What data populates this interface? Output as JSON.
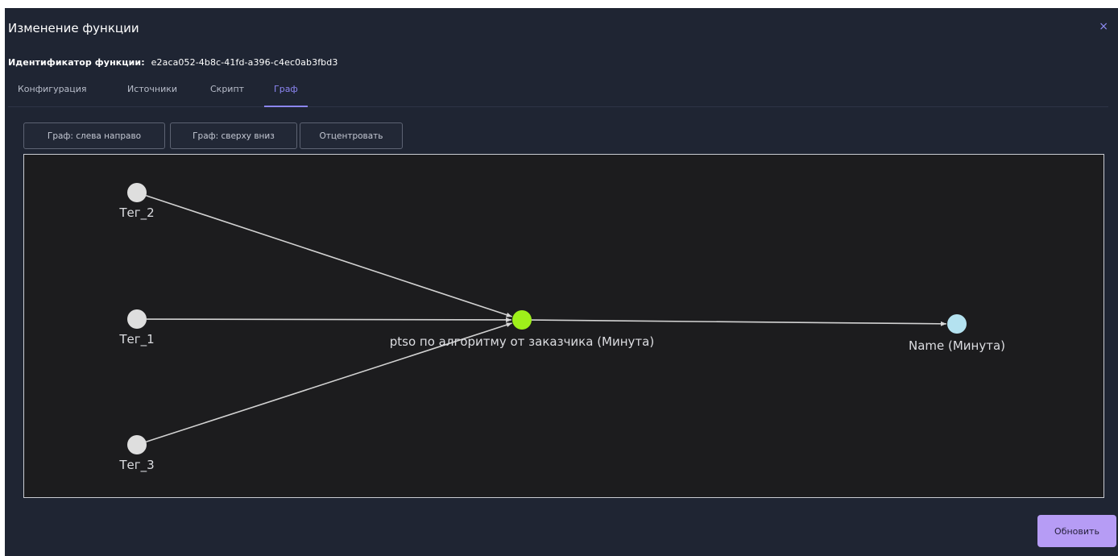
{
  "dialog": {
    "title": "Изменение функции",
    "close_symbol": "×",
    "function_id_label": "Идентификатор функции:",
    "function_id_value": "e2aca052-4b8c-41fd-a396-c4ec0ab3fbd3"
  },
  "tabs": [
    {
      "label": "Конфигурация",
      "active": false
    },
    {
      "label": "Источники",
      "active": false
    },
    {
      "label": "Скрипт",
      "active": false
    },
    {
      "label": "Граф",
      "active": true
    }
  ],
  "toolbar": {
    "left_to_right": "Граф: слева направо",
    "top_to_bottom": "Граф: сверху вниз",
    "center": "Отцентровать"
  },
  "graph": {
    "nodes": [
      {
        "id": "teg2",
        "label": "Тег_2",
        "color": "#dedede"
      },
      {
        "id": "teg1",
        "label": "Тег_1",
        "color": "#dedede"
      },
      {
        "id": "teg3",
        "label": "Тег_3",
        "color": "#dedede"
      },
      {
        "id": "func",
        "label": "ptso по алгоритму от заказчика (Минута)",
        "color": "#9ef01a"
      },
      {
        "id": "out",
        "label": "Name (Минута)",
        "color": "#b4e2f0"
      }
    ],
    "edges": [
      {
        "from": "teg2",
        "to": "func"
      },
      {
        "from": "teg1",
        "to": "func"
      },
      {
        "from": "teg3",
        "to": "func"
      },
      {
        "from": "func",
        "to": "out"
      }
    ]
  },
  "footer": {
    "update_label": "Обновить"
  },
  "colors": {
    "accent": "#8c86f3",
    "dialog_bg": "#1f2533",
    "canvas_bg": "#1c1c1e",
    "button_primary": "#b69cf5"
  }
}
